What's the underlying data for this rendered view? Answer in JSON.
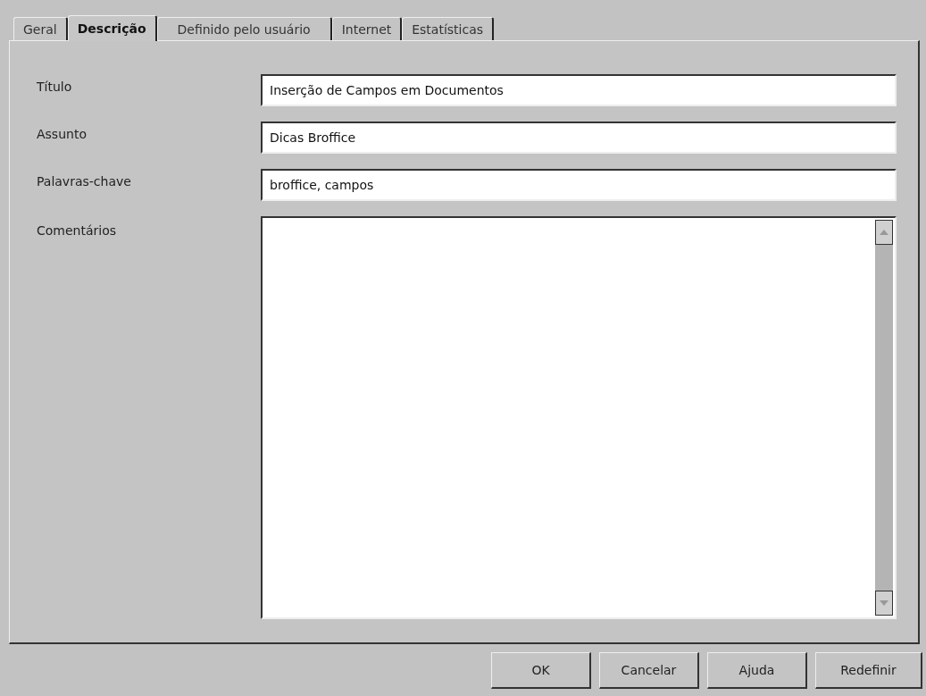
{
  "tabs": [
    {
      "label": "Geral",
      "selected": false
    },
    {
      "label": "Descrição",
      "selected": true
    },
    {
      "label": "Definido pelo usuário",
      "selected": false
    },
    {
      "label": "Internet",
      "selected": false
    },
    {
      "label": "Estatísticas",
      "selected": false
    }
  ],
  "fields": [
    {
      "kind": "line",
      "label": "Título",
      "value": "Inserção de Campos em Documentos"
    },
    {
      "kind": "line",
      "label": "Assunto",
      "value": "Dicas Broffice"
    },
    {
      "kind": "line",
      "label": "Palavras-chave",
      "value": "broffice, campos"
    },
    {
      "kind": "area",
      "label": "Comentários"
    }
  ],
  "buttons": [
    "OK",
    "Cancelar",
    "Ajuda",
    "Redefinir"
  ]
}
